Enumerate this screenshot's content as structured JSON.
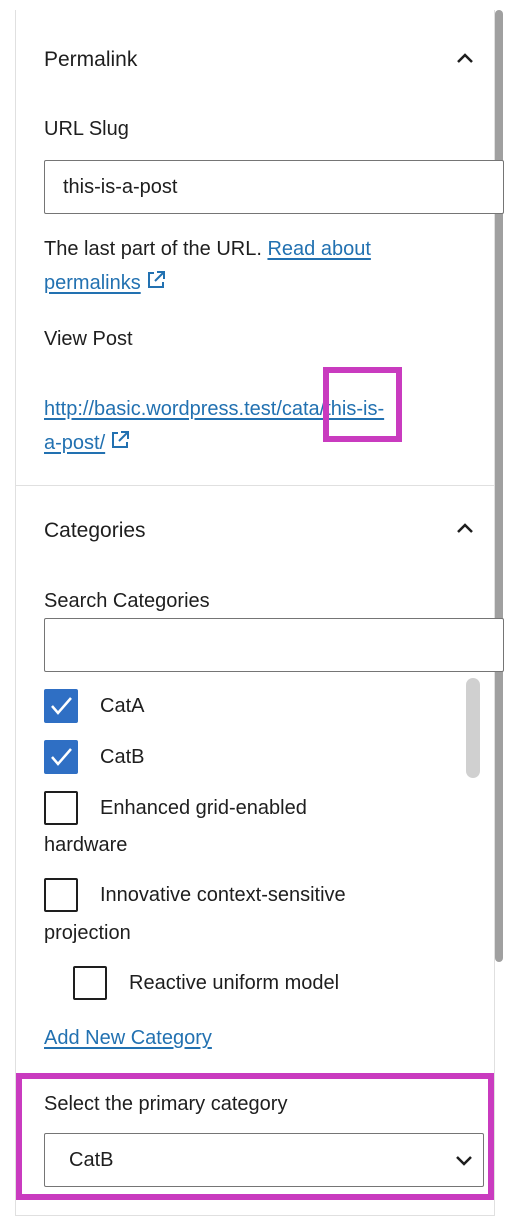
{
  "permalink": {
    "title": "Permalink",
    "slug_label": "URL Slug",
    "slug_value": "this-is-a-post",
    "help_text": "The last part of the URL.",
    "help_link": "Read about permalinks",
    "view_post_label": "View Post",
    "view_post_url_line1": "http://basic.wordpress.test/cata/this-is-",
    "view_post_url_line2": "a-post/"
  },
  "categories": {
    "title": "Categories",
    "search_label": "Search Categories",
    "search_value": "",
    "items": [
      {
        "label": "CatA",
        "checked": true
      },
      {
        "label": "CatB",
        "checked": true
      },
      {
        "label_line1": "Enhanced grid-enabled",
        "label_line2": "hardware",
        "checked": false
      },
      {
        "label_line1": "Innovative context-sensitive",
        "label_line2": "projection",
        "checked": false
      },
      {
        "label": "Reactive uniform model",
        "checked": false
      }
    ],
    "add_new": "Add New Category",
    "primary_label": "Select the primary category",
    "primary_value": "CatB"
  },
  "colors": {
    "link": "#2271b1",
    "checkbox_checked": "#2f6fc4",
    "highlight": "#c93bbf"
  },
  "icons": [
    "chevron-up-icon",
    "external-link-icon",
    "checkmark-icon",
    "chevron-down-icon"
  ]
}
